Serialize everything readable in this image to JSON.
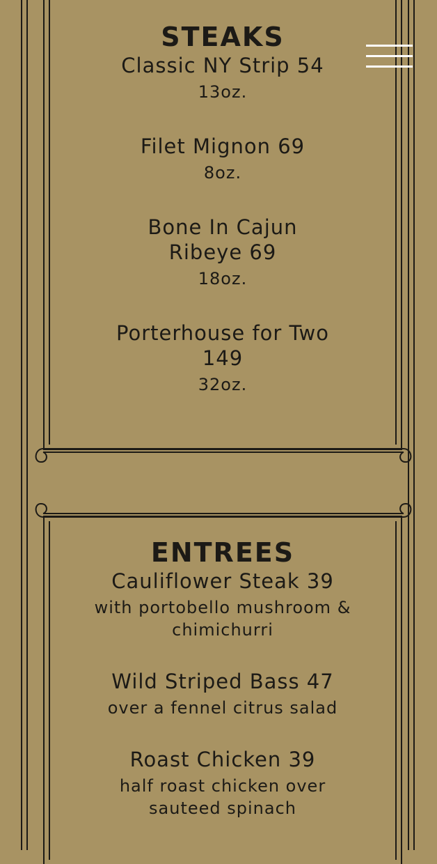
{
  "theme": {
    "background": "#a89363",
    "ink": "#1c1a16",
    "menu_icon": "#ffffff"
  },
  "header": {
    "menu_icon": "hamburger-menu-icon"
  },
  "steaks": {
    "title": "STEAKS",
    "items": [
      {
        "name": "Classic NY Strip 54",
        "desc": "13oz."
      },
      {
        "name": "Filet Mignon 69",
        "desc": "8oz."
      },
      {
        "name": "Bone In Cajun Ribeye 69",
        "desc": "18oz."
      },
      {
        "name": "Porterhouse for Two 149",
        "desc": "32oz."
      }
    ]
  },
  "entrees": {
    "title": "ENTREES",
    "items": [
      {
        "name": "Cauliflower Steak 39",
        "desc": "with portobello mushroom & chimichurri"
      },
      {
        "name": "Wild Striped Bass 47",
        "desc": "over a fennel citrus salad"
      },
      {
        "name": "Roast Chicken 39",
        "desc": "half roast chicken over sauteed spinach"
      }
    ]
  }
}
